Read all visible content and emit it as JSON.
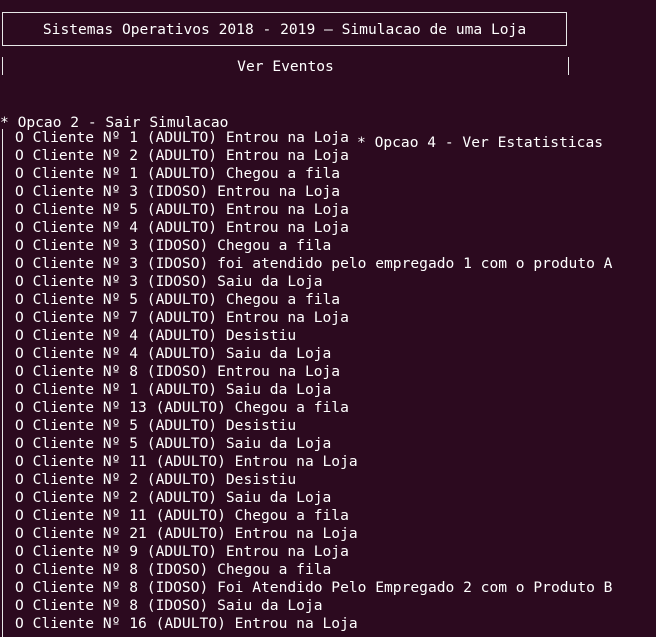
{
  "header": {
    "title": "Sistemas Operativos 2018 - 2019 — Simulacao de uma Loja"
  },
  "events_panel": {
    "title": "Ver Eventos"
  },
  "options": {
    "left": "* Opcao 2 - Sair Simulacao",
    "right": "* Opcao 4 - Ver Estatisticas"
  },
  "events": [
    "O Cliente Nº 1 (ADULTO) Entrou na Loja",
    "O Cliente Nº 2 (ADULTO) Entrou na Loja",
    "O Cliente Nº 1 (ADULTO) Chegou a fila",
    "O Cliente Nº 3 (IDOSO) Entrou na Loja",
    "O Cliente Nº 5 (ADULTO) Entrou na Loja",
    "O Cliente Nº 4 (ADULTO) Entrou na Loja",
    "O Cliente Nº 3 (IDOSO) Chegou a fila",
    "O Cliente Nº 3 (IDOSO) foi atendido pelo empregado 1 com o produto A",
    "O Cliente Nº 3 (IDOSO) Saiu da Loja",
    "O Cliente Nº 5 (ADULTO) Chegou a fila",
    "O Cliente Nº 7 (ADULTO) Entrou na Loja",
    "O Cliente Nº 4 (ADULTO) Desistiu",
    "O Cliente Nº 4 (ADULTO) Saiu da Loja",
    "O Cliente Nº 8 (IDOSO) Entrou na Loja",
    "O Cliente Nº 1 (ADULTO) Saiu da Loja",
    "O Cliente Nº 13 (ADULTO) Chegou a fila",
    "O Cliente Nº 5 (ADULTO) Desistiu",
    "O Cliente Nº 5 (ADULTO) Saiu da Loja",
    "O Cliente Nº 11 (ADULTO) Entrou na Loja",
    "O Cliente Nº 2 (ADULTO) Desistiu",
    "O Cliente Nº 2 (ADULTO) Saiu da Loja",
    "O Cliente Nº 11 (ADULTO) Chegou a fila",
    "O Cliente Nº 21 (ADULTO) Entrou na Loja",
    "O Cliente Nº 9 (ADULTO) Entrou na Loja",
    "O Cliente Nº 8 (IDOSO) Chegou a fila",
    "O Cliente Nº 8 (IDOSO) Foi Atendido Pelo Empregado 2 com o Produto B",
    "O Cliente Nº 8 (IDOSO) Saiu da Loja",
    "O Cliente Nº 16 (ADULTO) Entrou na Loja"
  ]
}
